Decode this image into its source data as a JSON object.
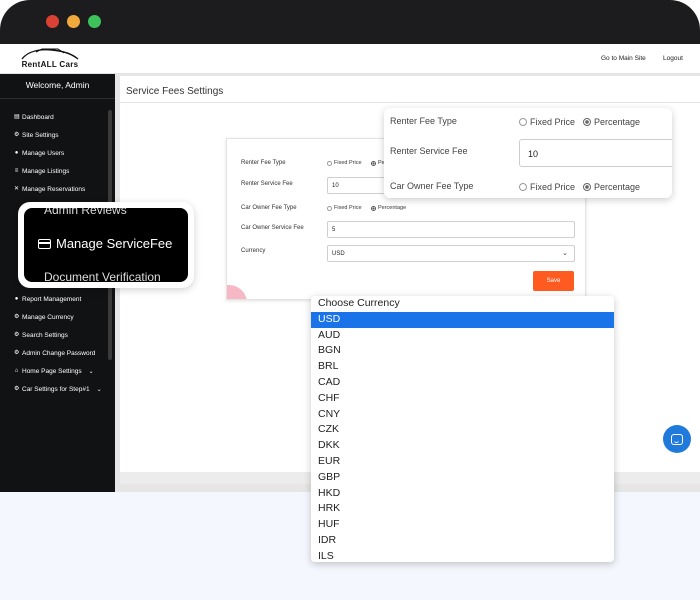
{
  "window": {
    "controls": [
      "close",
      "minimize",
      "maximize"
    ]
  },
  "topbar": {
    "logo_text": "RentALL Cars",
    "nav_main": "Go to Main Site",
    "nav_logout": "Logout"
  },
  "sidebar": {
    "welcome": "Welcome, Admin",
    "items": [
      {
        "label": "Dashboard",
        "icon": "chart-icon"
      },
      {
        "label": "Site Settings",
        "icon": "gear-icon"
      },
      {
        "label": "Manage Users",
        "icon": "user-icon"
      },
      {
        "label": "Manage Listings",
        "icon": "list-icon"
      },
      {
        "label": "Manage Reservations",
        "icon": "cross-icon"
      },
      {
        "label": "Report Management",
        "icon": "user-icon"
      },
      {
        "label": "Manage Currency",
        "icon": "gear-icon"
      },
      {
        "label": "Search Settings",
        "icon": "gear-icon"
      },
      {
        "label": "Admin Change Password",
        "icon": "gear-icon"
      },
      {
        "label": "Home Page Settings",
        "icon": "home-icon"
      },
      {
        "label": "Car Settings for Step#1",
        "icon": "gear-icon"
      }
    ]
  },
  "content": {
    "title": "Service Fees Settings"
  },
  "form": {
    "renter_fee_type_label": "Renter Fee Type",
    "fixed_price": "Fixed Price",
    "percentage": "Percentage",
    "percentage_partial": "Pe",
    "renter_service_fee_label": "Renter Service Fee",
    "renter_service_fee_value": "10",
    "owner_fee_type_label": "Car Owner Fee Type",
    "owner_service_fee_label": "Car Owner Service Fee",
    "owner_service_fee_value": "5",
    "currency_label": "Currency",
    "currency_value": "USD",
    "save_label": "Save"
  },
  "zoom_sidebar": {
    "top_label": "Admin Reviews",
    "mid_label": "Manage ServiceFee",
    "bottom_label": "Document Verification"
  },
  "zoom_fee": {
    "renter_fee_type_label": "Renter Fee Type",
    "renter_service_fee_label": "Renter Service Fee",
    "renter_service_fee_value": "10",
    "owner_fee_type_label": "Car Owner Fee Type",
    "fixed_price": "Fixed Price",
    "percentage": "Percentage"
  },
  "dropdown": {
    "header": "Choose Currency",
    "selected": "USD",
    "options": [
      "USD",
      "AUD",
      "BGN",
      "BRL",
      "CAD",
      "CHF",
      "CNY",
      "CZK",
      "DKK",
      "EUR",
      "GBP",
      "HKD",
      "HRK",
      "HUF",
      "IDR",
      "ILS"
    ]
  },
  "colors": {
    "accent": "#ff5a1f",
    "select_highlight": "#1a73e8",
    "sidebar_bg": "#111214",
    "chat": "#1f7adb"
  }
}
